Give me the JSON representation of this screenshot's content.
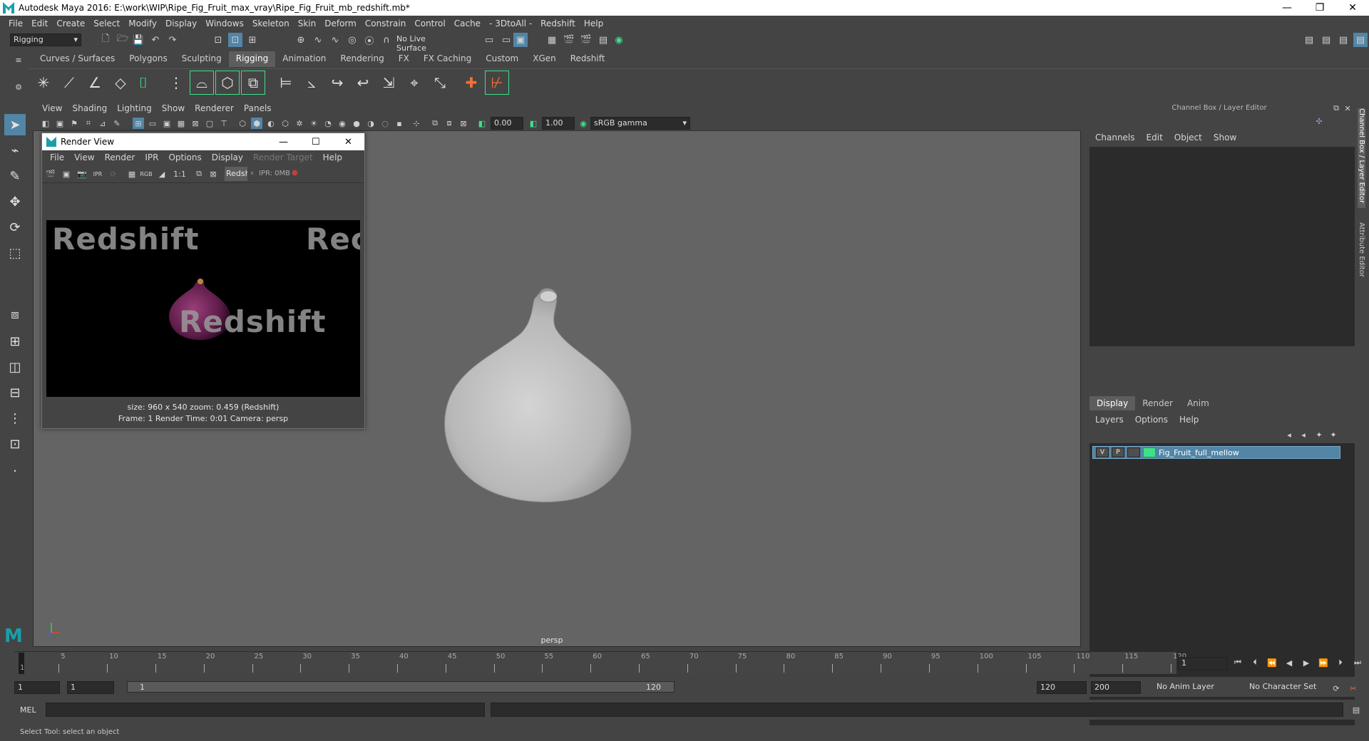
{
  "window": {
    "title": "Autodesk Maya 2016: E:\\work\\WIP\\Ripe_Fig_Fruit_max_vray\\Ripe_Fig_Fruit_mb_redshift.mb*",
    "minimize_glyph": "—",
    "restore_glyph": "❐",
    "close_glyph": "✕"
  },
  "menubar": [
    "File",
    "Edit",
    "Create",
    "Select",
    "Modify",
    "Display",
    "Windows",
    "Skeleton",
    "Skin",
    "Deform",
    "Constrain",
    "Control",
    "Cache",
    "- 3DtoAll -",
    "Redshift",
    "Help"
  ],
  "statusline": {
    "menuset": "Rigging",
    "live_surface": "No Live Surface"
  },
  "shelf": {
    "tabs": [
      "Curves / Surfaces",
      "Polygons",
      "Sculpting",
      "Rigging",
      "Animation",
      "Rendering",
      "FX",
      "FX Caching",
      "Custom",
      "XGen",
      "Redshift"
    ],
    "active_tab": "Rigging"
  },
  "viewport": {
    "menu": [
      "View",
      "Shading",
      "Lighting",
      "Show",
      "Renderer",
      "Panels"
    ],
    "exposure": "0.00",
    "gamma": "1.00",
    "colorspace": "sRGB gamma",
    "camera_label": "persp"
  },
  "render_view": {
    "title": "Render View",
    "menu": [
      "File",
      "View",
      "Render",
      "IPR",
      "Options",
      "Display",
      "Render Target",
      "Help"
    ],
    "disabled_menu_index": 6,
    "ratio_label": "1:1",
    "renderer_field": "Redsh",
    "ipr_status": "IPR: 0MB",
    "rgb_label": "RGB",
    "ipr_label": "IPR",
    "watermark": "Redshift",
    "watermark_partial": "Rec",
    "info_line1": "size: 960 x 540 zoom: 0.459      (Redshift)",
    "info_line2": "Frame: 1      Render Time: 0:01      Camera: persp"
  },
  "channel_box": {
    "header": "Channel Box / Layer Editor",
    "menu": [
      "Channels",
      "Edit",
      "Object",
      "Show"
    ]
  },
  "layer_editor": {
    "tabs": [
      "Display",
      "Render",
      "Anim"
    ],
    "active_tab": "Display",
    "menu": [
      "Layers",
      "Options",
      "Help"
    ],
    "layer": {
      "v": "V",
      "p": "P",
      "name": "Fig_Fruit_full_mellow",
      "color": "#3ee08a"
    }
  },
  "side_tabs": [
    "Channel Box / Layer Editor",
    "Attribute Editor"
  ],
  "timeline": {
    "start_marker": "1",
    "ticks": [
      "5",
      "10",
      "15",
      "20",
      "25",
      "30",
      "35",
      "40",
      "45",
      "50",
      "55",
      "60",
      "65",
      "70",
      "75",
      "80",
      "85",
      "90",
      "95",
      "100",
      "105",
      "110",
      "115",
      "120"
    ],
    "current_frame": "1"
  },
  "range": {
    "start": "1",
    "playback_start": "1",
    "slider_start": "1",
    "slider_end": "120",
    "playback_end": "120",
    "end": "200",
    "anim_layer": "No Anim Layer",
    "character_set": "No Character Set"
  },
  "command_line": {
    "label": "MEL"
  },
  "help_line": "Select Tool: select an object",
  "colors": {
    "accent_teal": "#1a9fa8",
    "selection_blue": "#5285a6",
    "viewport_bg": "#646464"
  }
}
